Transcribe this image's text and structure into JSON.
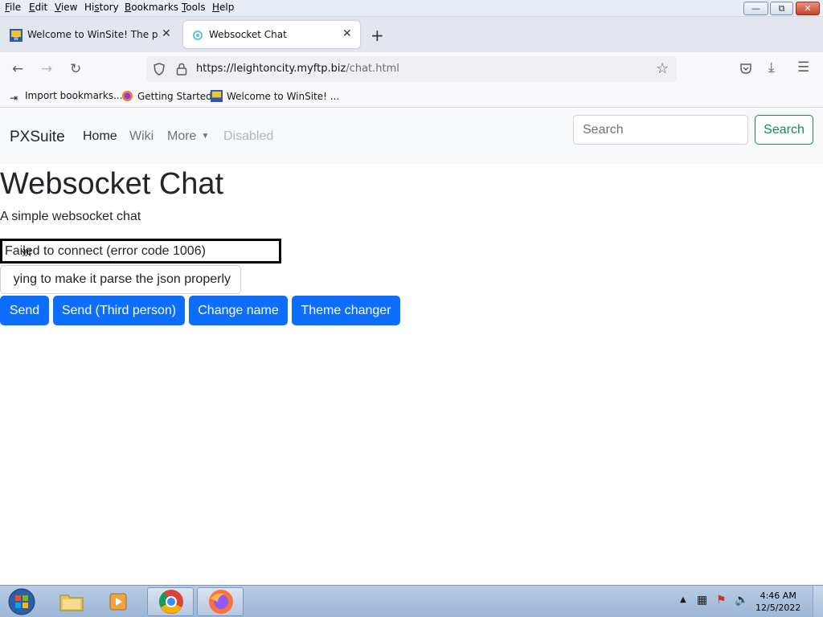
{
  "menubar": {
    "items": [
      "File",
      "Edit",
      "View",
      "History",
      "Bookmarks",
      "Tools",
      "Help"
    ],
    "mnemonics": [
      "F",
      "E",
      "V",
      "s",
      "B",
      "T",
      "H"
    ]
  },
  "tabs": [
    {
      "label": "Welcome to WinSite! The place",
      "active": false
    },
    {
      "label": "Websocket Chat",
      "active": true
    }
  ],
  "navbar": {
    "url_host": "https://leightoncity.myftp.biz",
    "url_path": "/chat.html"
  },
  "bookmarks": [
    {
      "label": "Import bookmarks...",
      "icon": "import-icon"
    },
    {
      "label": "Getting Started",
      "icon": "firefox-icon"
    },
    {
      "label": "Welcome to WinSite! ...",
      "icon": "winsite-icon"
    }
  ],
  "site": {
    "brand": "PXSuite",
    "nav": [
      {
        "label": "Home",
        "state": "active"
      },
      {
        "label": "Wiki",
        "state": "normal"
      },
      {
        "label": "More",
        "state": "dropdown"
      },
      {
        "label": "Disabled",
        "state": "disabled"
      }
    ],
    "search_placeholder": "Search",
    "search_button": "Search"
  },
  "main": {
    "title": "Websocket Chat",
    "subtitle": "A simple websocket chat",
    "status_text": "Failed to connect (error code 1006)",
    "message_value": "ying to make it parse the json properly",
    "buttons": [
      "Send",
      "Send (Third person)",
      "Change name",
      "Theme changer"
    ]
  },
  "taskbar": {
    "time": "4:46 AM",
    "date": "12/5/2022"
  },
  "colors": {
    "primary": "#0d6efd",
    "success": "#198754"
  }
}
